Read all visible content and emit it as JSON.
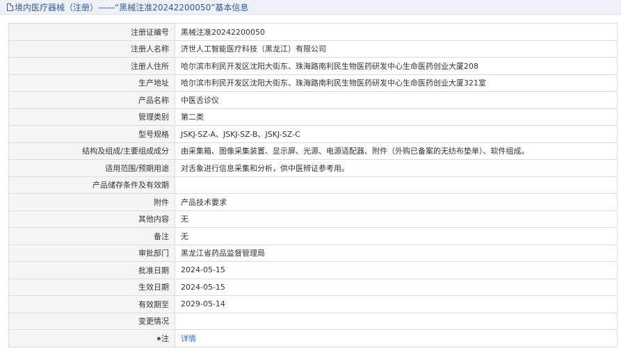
{
  "header": {
    "title": "境内医疗器械（注册）——“黑械注准20242200050”基本信息"
  },
  "rows": [
    {
      "label": "注册证编号",
      "value": "黑械注准20242200050"
    },
    {
      "label": "注册人名称",
      "value": "济世人工智能医疗科技（黑龙江）有限公司"
    },
    {
      "label": "注册人住所",
      "value": "哈尔滨市利民开发区沈阳大街东、珠海路南利民生物医药研发中心生命医药创业大厦208"
    },
    {
      "label": "生产地址",
      "value": "哈尔滨市利民开发区沈阳大街东、珠海路南利民生物医药研发中心生命医药创业大厦321室"
    },
    {
      "label": "产品名称",
      "value": "中医舌诊仪"
    },
    {
      "label": "管理类别",
      "value": "第二类"
    },
    {
      "label": "型号规格",
      "value": "JSKJ-SZ-A、JSKJ-SZ-B、JSKJ-SZ-C"
    },
    {
      "label": "结构及组成/主要组成成分",
      "value": "由采集箱、图像采集装置、显示屏、光源、电源适配器、附件（外购已备案的无纺布垫单）、软件组成。"
    },
    {
      "label": "适用范围/预期用途",
      "value": "对舌象进行信息采集和分析，供中医辨证参考用。"
    },
    {
      "label": "产品储存条件及有效期",
      "value": ""
    },
    {
      "label": "附件",
      "value": "产品技术要求"
    },
    {
      "label": "其他内容",
      "value": "无"
    },
    {
      "label": "备注",
      "value": "无"
    },
    {
      "label": "审批部门",
      "value": "黑龙江省药品监督管理局"
    },
    {
      "label": "批准日期",
      "value": "2024-05-15"
    },
    {
      "label": "生效日期",
      "value": "2024-05-15"
    },
    {
      "label": "有效期至",
      "value": "2029-05-14"
    },
    {
      "label": "变更情况",
      "value": ""
    }
  ],
  "note_row": {
    "label": "注",
    "link": "详情"
  }
}
